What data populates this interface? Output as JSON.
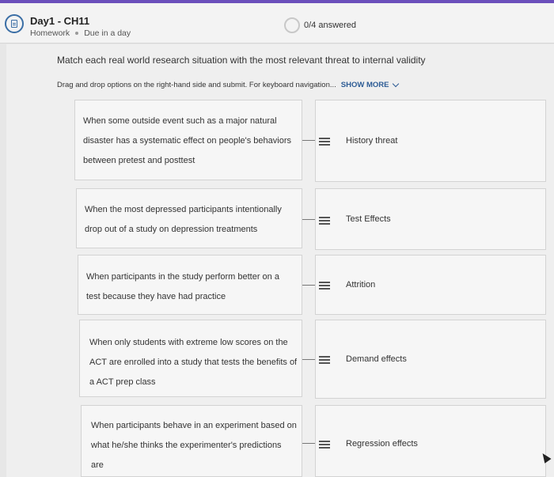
{
  "header": {
    "title": "Day1 - CH11",
    "type": "Homework",
    "due": "Due in a day",
    "progress": "0/4 answered"
  },
  "question": {
    "prompt": "Match each real world research situation with the most relevant threat to internal validity",
    "instructions": "Drag and drop options on the right-hand side and submit. For keyboard navigation...",
    "show_more": "SHOW MORE"
  },
  "matches": [
    {
      "situation": [
        "When some outside event such as a major natural",
        "disaster has a systematic effect on people's behaviors",
        "between pretest and posttest"
      ],
      "answer": "History threat"
    },
    {
      "situation": [
        "When the most depressed participants intentionally",
        "drop out of a study on depression treatments"
      ],
      "answer": "Test Effects"
    },
    {
      "situation": [
        "When participants in the study perform better on a",
        "test because they have had practice"
      ],
      "answer": "Attrition"
    },
    {
      "situation": [
        "When only students with extreme low scores on the",
        "ACT are enrolled into a study that tests the benefits of",
        "a ACT prep class"
      ],
      "answer": "Demand effects"
    },
    {
      "situation": [
        "When participants behave in an experiment based on",
        "what he/she thinks the experimenter's predictions",
        "are"
      ],
      "answer": "Regression effects"
    }
  ]
}
